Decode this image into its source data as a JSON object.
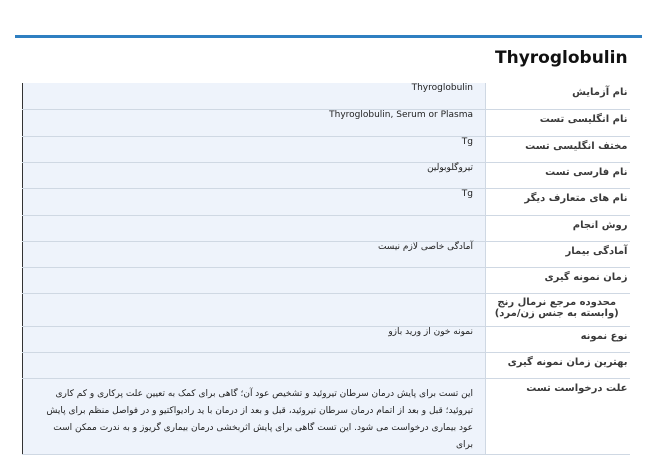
{
  "page_title": "Thyroglobulin",
  "rows": [
    {
      "label": "نام آزمایش",
      "value": "Thyroglobulin"
    },
    {
      "label": "نام انگلیسی تست",
      "value": "Thyroglobulin, Serum or Plasma"
    },
    {
      "label": "مختف انگلیسی تست",
      "value": "Tg"
    },
    {
      "label": "نام فارسی تست",
      "value": "تیروگلوبولین"
    },
    {
      "label": "نام های متعارف دیگر",
      "value": "Tg"
    },
    {
      "label": "روش انجام",
      "value": ""
    },
    {
      "label": "آمادگی بیمار",
      "value": "آمادگی خاصی لازم نیست"
    },
    {
      "label": "زمان نمونه گیری",
      "value": ""
    },
    {
      "label": "محدوده مرجع نرمال رنج (وابسته به جنس زن/مرد)",
      "value": ""
    },
    {
      "label": "نوع نمونه",
      "value": "نمونه خون از ورید بازو"
    },
    {
      "label": "بهترین زمان نمونه گیری",
      "value": ""
    },
    {
      "label": "علت درخواست تست",
      "value": "این تست برای پایش درمان سرطان تیروئید و تشخیص عود آن؛ گاهی برای کمک به تعیین علت پرکاری و کم کاری تیروئید؛ قبل و بعد از اتمام درمان سرطان تیروئید، قبل و بعد از درمان با ید رادیواکتیو و در فواصل منظم برای پایش عود بیماری درخواست می شود. این تست گاهی برای پایش اثربخشی درمان بیماری گریوز و به ندرت ممکن است برای"
    }
  ]
}
